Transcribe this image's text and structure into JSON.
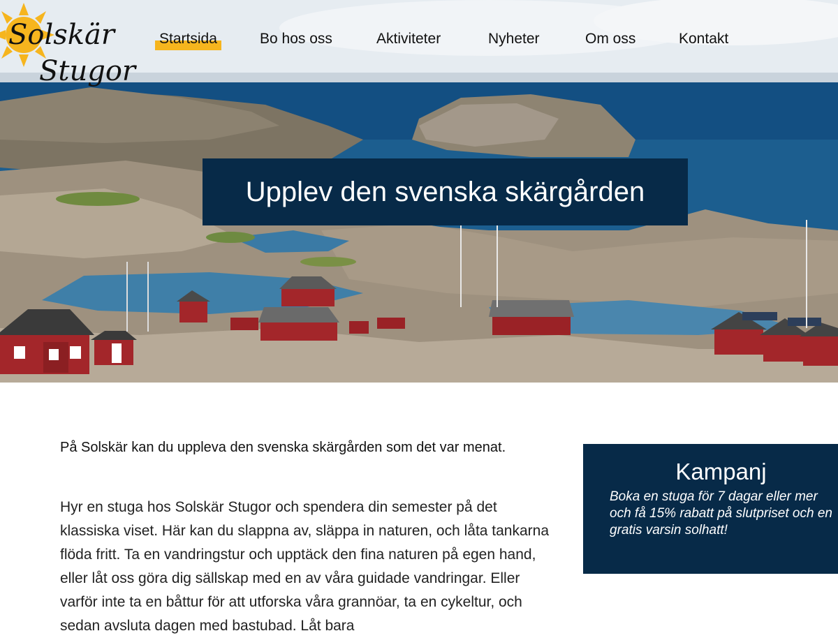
{
  "brand": {
    "logo_line_1": "Solskär",
    "logo_line_2": "Stugor",
    "sun_color": "#f6b51e"
  },
  "nav": {
    "items": [
      {
        "label": "Startsida",
        "active": true
      },
      {
        "label": "Bo hos oss",
        "active": false
      },
      {
        "label": "Aktiviteter",
        "active": false
      },
      {
        "label": "Nyheter",
        "active": false
      },
      {
        "label": "Om oss",
        "active": false
      },
      {
        "label": "Kontakt",
        "active": false
      }
    ],
    "highlight_color": "#f6b51e"
  },
  "hero": {
    "title": "Upplev den svenska skärgården",
    "image_description_icon": "archipelago-photo"
  },
  "content": {
    "intro": "På Solskär kan du uppleva den svenska skärgården som det var menat.",
    "body": "Hyr en stuga hos Solskär Stugor och spendera din semester på det klassiska viset. Här kan du slappna av, släppa in naturen, och låta tankarna flöda fritt. Ta en vandringstur och upptäck den fina naturen på egen hand, eller låt oss göra dig sällskap med en av våra guidade vandringar. Eller varför inte ta en båttur för att utforska våra grannöar, ta en cykeltur, och sedan avsluta dagen med bastubad. Låt bara"
  },
  "campaign": {
    "title": "Kampanj",
    "text": "Boka en stuga för 7 dagar eller mer och få 15% rabatt på slutpriset och en gratis varsin solhatt!"
  },
  "colors": {
    "navy": "#072a48",
    "accent": "#f6b51e"
  }
}
